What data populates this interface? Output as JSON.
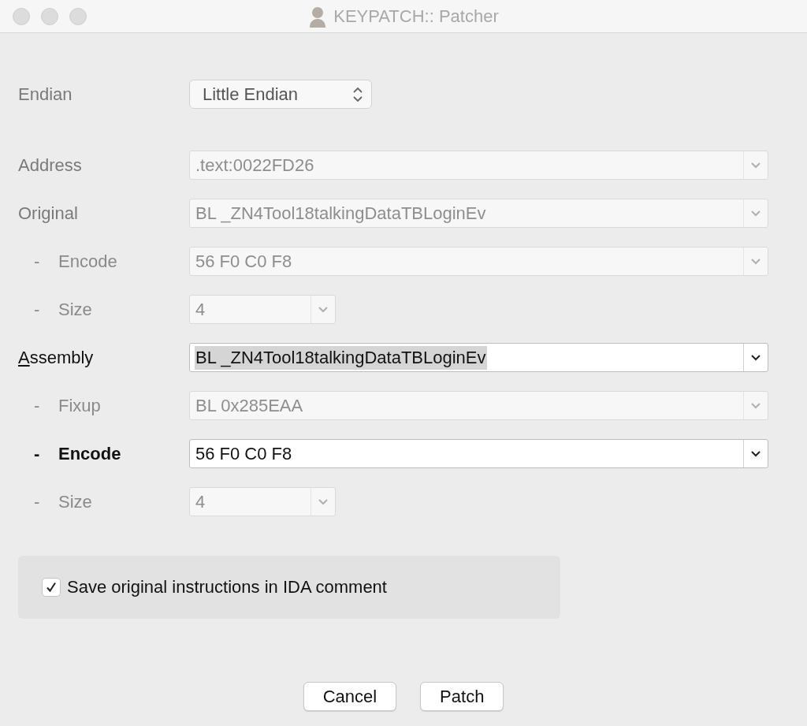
{
  "window": {
    "title": "KEYPATCH:: Patcher"
  },
  "endian": {
    "label": "Endian",
    "value": "Little Endian"
  },
  "rows": [
    {
      "label": "Address",
      "prefix": "",
      "kind": "wide",
      "value": ".text:0022FD26",
      "enabled": false,
      "bold": false,
      "mnemonic": false,
      "highlighted": false
    },
    {
      "label": "Original",
      "prefix": "",
      "kind": "wide",
      "value": "BL _ZN4Tool18talkingDataTBLoginEv",
      "enabled": false,
      "bold": false,
      "mnemonic": false,
      "highlighted": false
    },
    {
      "label": "Encode",
      "prefix": "-",
      "kind": "wide",
      "value": "56 F0 C0 F8",
      "enabled": false,
      "bold": false,
      "mnemonic": false,
      "highlighted": false
    },
    {
      "label": "Size",
      "prefix": "-",
      "kind": "narrow",
      "value": "4",
      "enabled": false,
      "bold": false,
      "mnemonic": false,
      "highlighted": false
    },
    {
      "label": "Assembly",
      "prefix": "",
      "kind": "wide",
      "value": "BL _ZN4Tool18talkingDataTBLoginEv",
      "enabled": true,
      "bold": false,
      "mnemonic": true,
      "highlighted": true
    },
    {
      "label": "Fixup",
      "prefix": "-",
      "kind": "wide",
      "value": "BL 0x285EAA",
      "enabled": false,
      "bold": false,
      "mnemonic": false,
      "highlighted": false
    },
    {
      "label": "Encode",
      "prefix": "-",
      "kind": "wide",
      "value": "56 F0 C0 F8",
      "enabled": true,
      "bold": true,
      "mnemonic": false,
      "highlighted": false
    },
    {
      "label": "Size",
      "prefix": "-",
      "kind": "narrow",
      "value": "4",
      "enabled": false,
      "bold": false,
      "mnemonic": false,
      "highlighted": false
    }
  ],
  "save_comment": {
    "label": "Save original instructions in IDA comment",
    "checked": true
  },
  "buttons": [
    {
      "label": "Cancel"
    },
    {
      "label": "Patch"
    }
  ]
}
